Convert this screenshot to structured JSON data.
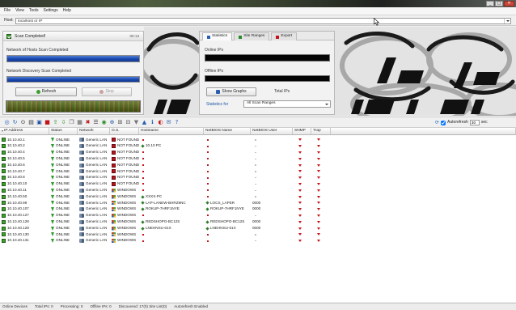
{
  "window": {
    "controls": [
      {
        "name": "minimize-icon",
        "glyph": "_"
      },
      {
        "name": "maximize-icon",
        "glyph": "□"
      },
      {
        "name": "close-icon",
        "glyph": "✕"
      }
    ]
  },
  "menu": {
    "items": [
      "File",
      "View",
      "Tools",
      "Settings",
      "Help"
    ]
  },
  "host": {
    "label": "Host:",
    "value": "localhost or IP"
  },
  "scan_panel": {
    "title": "Scan Completed!",
    "elapsed": "00:13",
    "hosts_label": "Network of Hosts Scan Completed",
    "hosts_progress": 1.0,
    "discovery_label": "Network Discovery Scan Completed",
    "discovery_progress": 1.0,
    "refresh_label": "Refresh",
    "stop_label": "Stop"
  },
  "stats_panel": {
    "tabs": [
      "Statistics",
      "Site Ranges",
      "Export"
    ],
    "active_tab": 0,
    "online_label": "Online IPs",
    "offline_label": "Offline IPs",
    "show_graphs_label": "Show Graphs",
    "total_label": "Total IPs",
    "stats_for_label": "Statistics for",
    "stats_for_value": "All Scan Ranges"
  },
  "toolbar": {
    "icons": [
      {
        "name": "search-icon",
        "glyph": "◎",
        "color": "#2a5fb0"
      },
      {
        "name": "refresh-icon",
        "glyph": "↻",
        "color": "#2a5fb0"
      },
      {
        "name": "binoculars-icon",
        "glyph": "⊙",
        "color": "#333333"
      },
      {
        "name": "scan-range-icon",
        "glyph": "▤",
        "color": "#333333"
      },
      {
        "name": "save-icon",
        "glyph": "▣",
        "color": "#1e4fa0"
      },
      {
        "name": "stop-icon",
        "glyph": "■",
        "color": "#c0141a"
      },
      {
        "name": "export-icon",
        "glyph": "⇪",
        "color": "#2a8a2a"
      },
      {
        "name": "import-icon",
        "glyph": "⇩",
        "color": "#2a8a2a"
      },
      {
        "name": "copy-icon",
        "glyph": "❐",
        "color": "#555555"
      },
      {
        "name": "grid-icon",
        "glyph": "▦",
        "color": "#555555"
      },
      {
        "name": "delete-icon",
        "glyph": "✖",
        "color": "#c0141a"
      },
      {
        "name": "properties-icon",
        "glyph": "☰",
        "color": "#444444"
      },
      {
        "name": "ping-icon",
        "glyph": "◉",
        "color": "#2a8a2a"
      },
      {
        "name": "trace-icon",
        "glyph": "⊕",
        "color": "#2a5fb0"
      },
      {
        "name": "zoom-in-icon",
        "glyph": "⊞",
        "color": "#555555"
      },
      {
        "name": "zoom-out-icon",
        "glyph": "⊟",
        "color": "#555555"
      },
      {
        "name": "filter-icon",
        "glyph": "▼",
        "color": "#777777"
      },
      {
        "name": "up-icon",
        "glyph": "▲",
        "color": "#2a5fb0"
      },
      {
        "name": "info-icon",
        "glyph": "ℹ",
        "color": "#2a5fb0"
      },
      {
        "name": "web-icon",
        "glyph": "◐",
        "color": "#c0141a"
      },
      {
        "name": "mail-icon",
        "glyph": "✉",
        "color": "#2a5fb0"
      },
      {
        "name": "help-icon",
        "glyph": "?",
        "color": "#2a5fb0"
      }
    ],
    "autorefresh": {
      "icon": "⟳",
      "label": "Autorefresh",
      "checked": true,
      "value": "30",
      "unit": "sec"
    }
  },
  "table": {
    "columns": [
      "IP Address",
      "Status",
      "Network",
      "O.S.",
      "Hostname",
      "NetBIOS Name",
      "NetBIOS User",
      "SNMP",
      "Trap"
    ],
    "rows": [
      {
        "ip": "10.10.40.1",
        "status": "ONLINE",
        "network": "Generic LAN",
        "os": "NOT FOUND",
        "hostname": "",
        "netbios_name": "",
        "netbios_user": ""
      },
      {
        "ip": "10.10.40.2",
        "status": "ONLINE",
        "network": "Generic LAN",
        "os": "NOT FOUND",
        "hostname": "10.10 PC",
        "netbios_name": "",
        "netbios_user": ""
      },
      {
        "ip": "10.10.40.4",
        "status": "ONLINE",
        "network": "Generic LAN",
        "os": "NOT FOUND",
        "hostname": "",
        "netbios_name": "",
        "netbios_user": ""
      },
      {
        "ip": "10.10.40.5",
        "status": "ONLINE",
        "network": "Generic LAN",
        "os": "NOT FOUND",
        "hostname": "",
        "netbios_name": "",
        "netbios_user": ""
      },
      {
        "ip": "10.10.40.6",
        "status": "ONLINE",
        "network": "Generic LAN",
        "os": "NOT FOUND",
        "hostname": "",
        "netbios_name": "",
        "netbios_user": ""
      },
      {
        "ip": "10.10.40.7",
        "status": "ONLINE",
        "network": "Generic LAN",
        "os": "NOT FOUND",
        "hostname": "",
        "netbios_name": "",
        "netbios_user": ""
      },
      {
        "ip": "10.10.40.8",
        "status": "ONLINE",
        "network": "Generic LAN",
        "os": "NOT FOUND",
        "hostname": "",
        "netbios_name": "",
        "netbios_user": ""
      },
      {
        "ip": "10.10.40.10",
        "status": "ONLINE",
        "network": "Generic LAN",
        "os": "NOT FOUND",
        "hostname": "",
        "netbios_name": "",
        "netbios_user": ""
      },
      {
        "ip": "10.10.40.11",
        "status": "ONLINE",
        "network": "Generic LAN",
        "os": "WINDOWS",
        "hostname": "",
        "netbios_name": "",
        "netbios_user": ""
      },
      {
        "ip": "10.10.40.50",
        "status": "ONLINE",
        "network": "Generic LAN",
        "os": "WINDOWS",
        "hostname": "XXXX-PC",
        "netbios_name": "",
        "netbios_user": ""
      },
      {
        "ip": "10.10.40.99",
        "status": "ONLINE",
        "network": "Generic LAN",
        "os": "WINDOWS",
        "hostname": "LAP-LANEW-BHRZ9NC",
        "netbios_name": "LOCS_LAPER",
        "netbios_user": "0000"
      },
      {
        "ip": "10.10.40.107",
        "status": "ONLINE",
        "network": "Generic LAN",
        "os": "WINDOWS",
        "hostname": "ROKUP-7HRF1NYE",
        "netbios_name": "ROKUP-7HRF1NYE",
        "netbios_user": "0000"
      },
      {
        "ip": "10.10.40.127",
        "status": "ONLINE",
        "network": "Generic LAN",
        "os": "WINDOWS",
        "hostname": "",
        "netbios_name": "",
        "netbios_user": ""
      },
      {
        "ip": "10.10.40.128",
        "status": "ONLINE",
        "network": "Generic LAN",
        "os": "WINDOWS",
        "hostname": "REDSHOPO-BC12S",
        "netbios_name": "REDSHOPO-BC12S",
        "netbios_user": "0000"
      },
      {
        "ip": "10.10.40.129",
        "status": "ONLINE",
        "network": "Generic LAN",
        "os": "WINDOWS",
        "hostname": "LNEHNSU-01X",
        "netbios_name": "LNEHNSU-01X",
        "netbios_user": "0000"
      },
      {
        "ip": "10.10.40.130",
        "status": "ONLINE",
        "network": "Generic LAN",
        "os": "WINDOWS",
        "hostname": "",
        "netbios_name": "",
        "netbios_user": ""
      },
      {
        "ip": "10.10.40.131",
        "status": "ONLINE",
        "network": "Generic LAN",
        "os": "WINDOWS",
        "hostname": "",
        "netbios_name": "",
        "netbios_user": ""
      }
    ]
  },
  "status_bar": {
    "items": [
      "Online Devices",
      "Total IPs: 0",
      "Processing: 0",
      "Offline IPs: 0",
      "Discovered: 17(0) Site List(0)",
      "Autorefresh Enabled"
    ]
  },
  "colors": {
    "progress_blue": "#1846ad",
    "online_green": "#2f9a2f",
    "alert_red": "#c4161c",
    "link_blue": "#1f56a8"
  }
}
